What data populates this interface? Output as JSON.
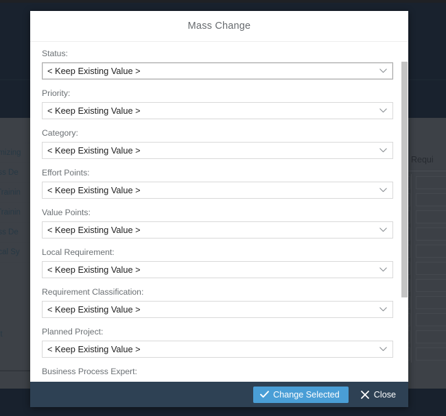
{
  "background": {
    "left_list": [
      "stomizing",
      "iness De",
      "er Trainin",
      "er Trainin",
      "iness De",
      "hnical Sy"
    ],
    "left_footer_label": "ment",
    "right_table": {
      "header": "Requi",
      "row_count": 11
    }
  },
  "dialog": {
    "title": "Mass Change",
    "keep_existing_value": "< Keep Existing Value >",
    "fields": [
      {
        "label": "Status:",
        "value": "< Keep Existing Value >",
        "focused": true
      },
      {
        "label": "Priority:",
        "value": "< Keep Existing Value >",
        "focused": false
      },
      {
        "label": "Category:",
        "value": "< Keep Existing Value >",
        "focused": false
      },
      {
        "label": "Effort Points:",
        "value": "< Keep Existing Value >",
        "focused": false
      },
      {
        "label": "Value Points:",
        "value": "< Keep Existing Value >",
        "focused": false
      },
      {
        "label": "Local Requirement:",
        "value": "< Keep Existing Value >",
        "focused": false
      },
      {
        "label": "Requirement Classification:",
        "value": "< Keep Existing Value >",
        "focused": false
      },
      {
        "label": "Planned Project:",
        "value": "< Keep Existing Value >",
        "focused": false
      },
      {
        "label": "Business Process Expert:",
        "value": "",
        "focused": false
      }
    ],
    "footer": {
      "primary_label": "Change Selected",
      "primary_icon": "check-icon",
      "close_label": "Close",
      "close_icon": "close-x-icon"
    },
    "scroll": {
      "thumb_top_pct": 5,
      "thumb_height_pct": 64
    }
  },
  "colors": {
    "accent_blue": "#4a9ed6",
    "footer_bar": "#2e4154",
    "overlay_dark": "#1c2733",
    "content_gray": "#6d6d6d",
    "label_gray": "#6a6f73",
    "scroll_thumb": "#c4c4c4"
  }
}
